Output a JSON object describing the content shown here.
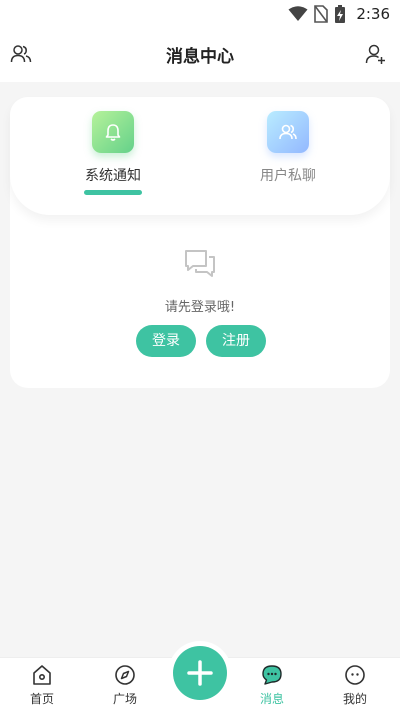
{
  "status_bar": {
    "time": "2:36",
    "icons": [
      "wifi-icon",
      "no-sim-icon",
      "battery-charging-icon"
    ]
  },
  "header": {
    "title": "消息中心",
    "left_icon": "contacts-icon",
    "right_icon": "add-friend-icon"
  },
  "tabs": [
    {
      "label": "系统通知",
      "icon": "bell-icon",
      "active": true
    },
    {
      "label": "用户私聊",
      "icon": "users-icon",
      "active": false
    }
  ],
  "empty_state": {
    "icon": "chat-bubbles-icon",
    "text": "请先登录哦!"
  },
  "actions": {
    "login_label": "登录",
    "register_label": "注册"
  },
  "bottom_nav": {
    "items": [
      {
        "label": "首页",
        "icon": "home-icon",
        "active": false
      },
      {
        "label": "广场",
        "icon": "compass-icon",
        "active": false
      },
      {
        "label": "消息",
        "icon": "message-icon",
        "active": true
      },
      {
        "label": "我的",
        "icon": "profile-face-icon",
        "active": false
      }
    ],
    "center_button_icon": "plus-icon"
  },
  "colors": {
    "accent": "#3ec3a2",
    "background": "#f5f5f5",
    "card": "#ffffff"
  }
}
